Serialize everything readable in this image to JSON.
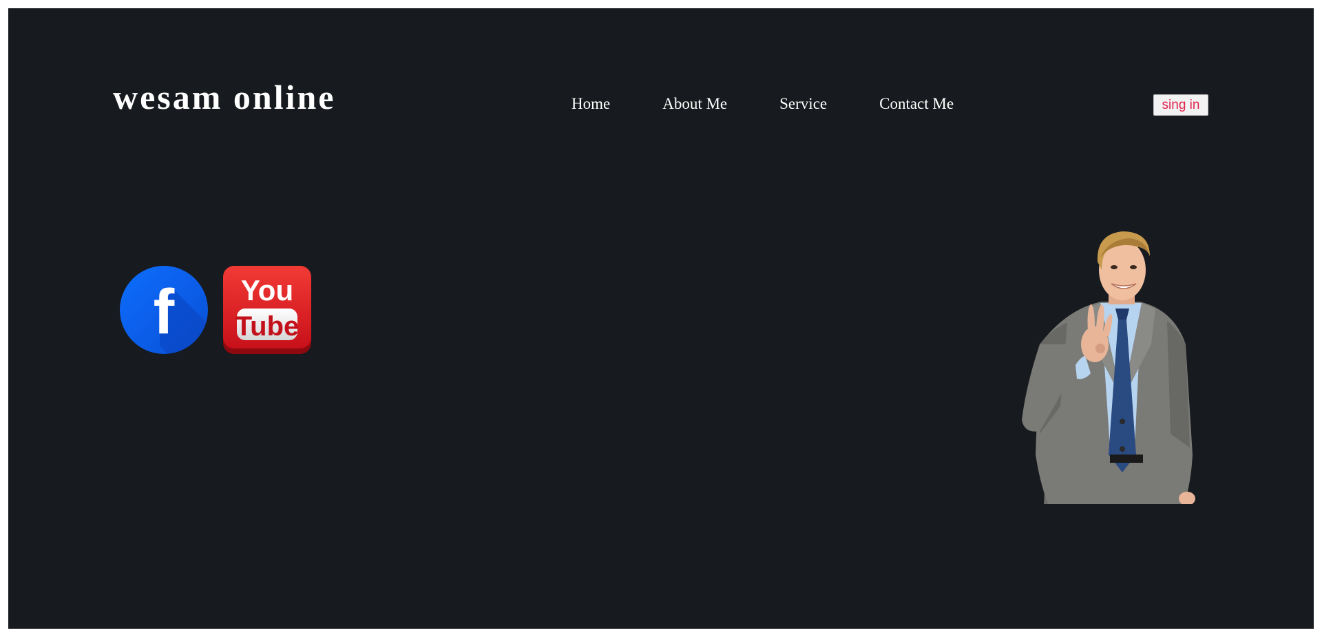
{
  "header": {
    "logo_text": "wesam online",
    "nav": {
      "home": "Home",
      "about": "About Me",
      "service": "Service",
      "contact": "Contact Me"
    },
    "signin_label": "sing in"
  },
  "social": {
    "facebook": {
      "icon": "facebook-icon",
      "glyph": "f",
      "color": "#0a63e8"
    },
    "youtube": {
      "icon": "youtube-icon",
      "line1": "You",
      "line2": "Tube",
      "color": "#e3161e"
    }
  },
  "hero": {
    "image": "businessman-photo"
  },
  "colors": {
    "background": "#171a1e",
    "text": "#ffffff",
    "signin_text": "#e0234e"
  }
}
